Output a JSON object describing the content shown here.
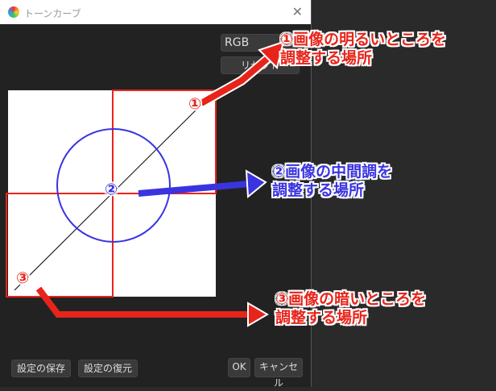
{
  "window": {
    "title": "トーンカーブ",
    "close": "✕"
  },
  "channel_select": "RGB",
  "reset_label": "リセット",
  "buttons": {
    "save": "設定の保存",
    "restore": "設定の復元",
    "ok": "OK",
    "cancel": "キャンセル"
  },
  "markers": {
    "m1": "①",
    "m2": "②",
    "m3": "③"
  },
  "annotations": {
    "a1": {
      "line1": "①画像の明るいところを",
      "line2": "調整する場所"
    },
    "a2": {
      "line1": "②画像の中間調を",
      "line2": "調整する場所"
    },
    "a3": {
      "line1": "③画像の暗いところを",
      "line2": "調整する場所"
    }
  },
  "colors": {
    "red": "#e8241a",
    "blue": "#3a34e0"
  }
}
